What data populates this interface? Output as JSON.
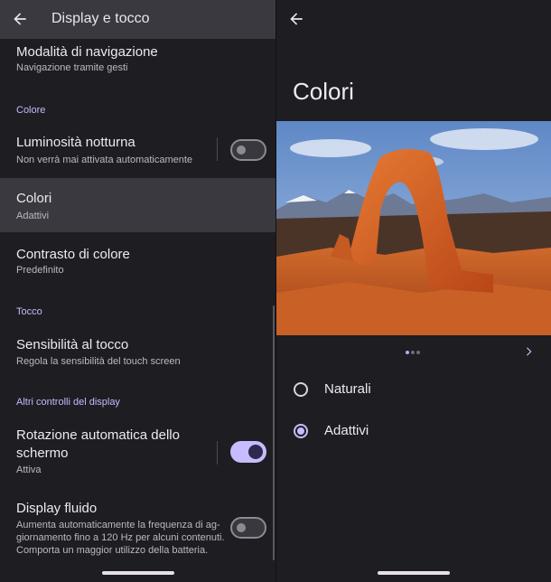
{
  "left": {
    "header": {
      "title": "Display e tocco"
    },
    "items": [
      {
        "title": "Modalità di navigazione",
        "subtitle": "Navigazione tramite gesti"
      },
      {
        "title": "Luminosità notturna",
        "subtitle": "Non verrà mai attivata automaticamente",
        "toggle": false
      },
      {
        "title": "Colori",
        "subtitle": "Adattivi"
      },
      {
        "title": "Contrasto di colore",
        "subtitle": "Predefinito"
      },
      {
        "title": "Sensibilità al tocco",
        "subtitle": "Regola la sensibilità del touch screen"
      },
      {
        "title_line1": "Rotazione automatica dello",
        "title_line2": "schermo",
        "subtitle": "Attiva",
        "toggle": true
      },
      {
        "title": "Display fluido",
        "subtitle_line1": "Aumenta automaticamente la frequenza di ag-",
        "subtitle_line2": "giornamento fino a 120 Hz per alcuni contenuti.",
        "subtitle_line3": "Comporta un maggior utilizzo della batteria.",
        "toggle": false
      }
    ],
    "sections": [
      "Colore",
      "Tocco",
      "Altri controlli del display"
    ]
  },
  "right": {
    "title": "Colori",
    "carousel": {
      "pages": 3,
      "active": 0
    },
    "options": [
      {
        "label": "Naturali",
        "selected": false
      },
      {
        "label": "Adattivi",
        "selected": true
      }
    ]
  },
  "colors": {
    "accent": "#c9bbff",
    "background": "#1e1d22",
    "highlight": "#3a393f"
  }
}
